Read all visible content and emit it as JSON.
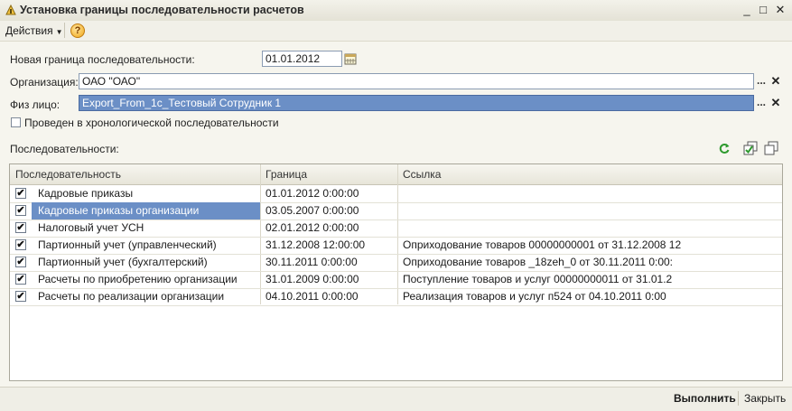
{
  "window": {
    "title": "Установка границы последовательности расчетов",
    "minimize": "_",
    "maximize": "□",
    "close": "✕"
  },
  "toolbar": {
    "actions_label": "Действия",
    "help_label": "?"
  },
  "form": {
    "boundary_label": "Новая граница последовательности:",
    "boundary_value": "01.01.2012",
    "org_label": "Организация:",
    "org_value": "ОАО \"ОАО\"",
    "person_label": "Физ лицо:",
    "person_value": "Export_From_1c_Тестовый Сотрудник 1",
    "chrono_label": "Проведен в хронологической последовательности",
    "chrono_checked": false,
    "select_glyph": "...",
    "clear_glyph": "✕"
  },
  "sequences": {
    "label": "Последовательности:",
    "columns": [
      "Последовательность",
      "Граница",
      "Ссылка"
    ],
    "rows": [
      {
        "checked": true,
        "name": "Кадровые приказы",
        "boundary": "01.01.2012 0:00:00",
        "link": ""
      },
      {
        "checked": true,
        "name": "Кадровые приказы организации",
        "boundary": "03.05.2007 0:00:00",
        "link": "",
        "selected": true
      },
      {
        "checked": true,
        "name": "Налоговый учет УСН",
        "boundary": "02.01.2012 0:00:00",
        "link": ""
      },
      {
        "checked": true,
        "name": "Партионный учет (управленческий)",
        "boundary": "31.12.2008 12:00:00",
        "link": "Оприходование товаров 00000000001 от 31.12.2008 12"
      },
      {
        "checked": true,
        "name": "Партионный учет (бухгалтерский)",
        "boundary": "30.11.2011 0:00:00",
        "link": "Оприходование товаров _18zeh_0 от 30.11.2011 0:00:"
      },
      {
        "checked": true,
        "name": "Расчеты по приобретению организации",
        "boundary": "31.01.2009 0:00:00",
        "link": "Поступление товаров и услуг 00000000011 от 31.01.2"
      },
      {
        "checked": true,
        "name": "Расчеты по реализации организации",
        "boundary": "04.10.2011 0:00:00",
        "link": "Реализация товаров и услуг п524 от 04.10.2011 0:00"
      }
    ],
    "check_glyph": "✔"
  },
  "footer": {
    "execute_label": "Выполнить",
    "close_label": "Закрыть"
  },
  "colors": {
    "selection": "#6b8fc6",
    "refresh_icon": "#2e9a2e"
  }
}
